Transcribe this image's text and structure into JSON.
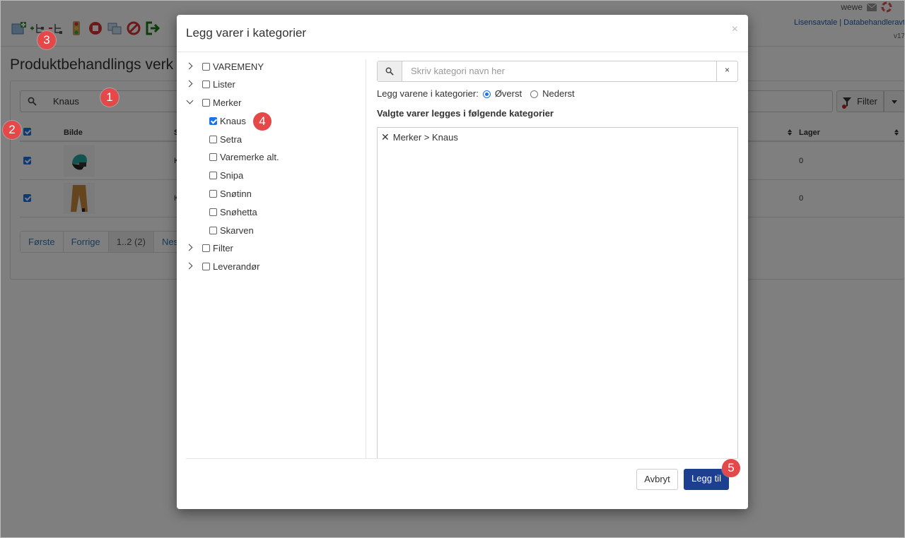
{
  "app": {
    "user": "wewe",
    "links": "Lisensavtale |  Databehandleravt",
    "version": "v17",
    "page_title": "Produktbehandlings verk",
    "search_value": "Knaus",
    "filter_label": "Filter",
    "table": {
      "columns": [
        "Bilde",
        "S",
        "Lager"
      ],
      "rows": [
        {
          "prefix": "K",
          "lager": "0",
          "checked": true
        },
        {
          "prefix": "K",
          "lager": "0",
          "checked": true
        }
      ]
    },
    "pager": [
      "Første",
      "Forrige",
      "1..2 (2)",
      "Nest"
    ]
  },
  "modal": {
    "title": "Legg varer i kategorier",
    "close_label": "×",
    "tree": [
      {
        "label": "VAREMENY",
        "level": 0,
        "expander": "right",
        "checked": false
      },
      {
        "label": "Lister",
        "level": 0,
        "expander": "right",
        "checked": false
      },
      {
        "label": "Merker",
        "level": 0,
        "expander": "down",
        "checked": false
      },
      {
        "label": "Knaus",
        "level": 1,
        "expander": "none",
        "checked": true
      },
      {
        "label": "Setra",
        "level": 1,
        "expander": "none",
        "checked": false
      },
      {
        "label": "Varemerke alt.",
        "level": 1,
        "expander": "none",
        "checked": false
      },
      {
        "label": "Snipa",
        "level": 1,
        "expander": "none",
        "checked": false
      },
      {
        "label": "Snøtinn",
        "level": 1,
        "expander": "none",
        "checked": false
      },
      {
        "label": "Snøhetta",
        "level": 1,
        "expander": "none",
        "checked": false
      },
      {
        "label": "Skarven",
        "level": 1,
        "expander": "none",
        "checked": false
      },
      {
        "label": "Filter",
        "level": 0,
        "expander": "right",
        "checked": false
      },
      {
        "label": "Leverandør",
        "level": 0,
        "expander": "right",
        "checked": false
      }
    ],
    "search_placeholder": "Skriv kategori navn her",
    "clear_label": "×",
    "placement_label": "Legg varene i kategorier:",
    "placement_options": [
      {
        "label": "Øverst",
        "selected": true
      },
      {
        "label": "Nederst",
        "selected": false
      }
    ],
    "selected_heading": "Valgte varer legges i følgende kategorier",
    "selected_items": [
      "Merker > Knaus"
    ],
    "cancel_label": "Avbryt",
    "submit_label": "Legg til"
  },
  "markers": [
    "1",
    "2",
    "3",
    "4",
    "5"
  ],
  "colors": {
    "primary": "#1d3f8f",
    "checkbox": "#1a73e8",
    "marker": "#e54848",
    "overlay": "rgba(0,0,0,0.5)"
  }
}
